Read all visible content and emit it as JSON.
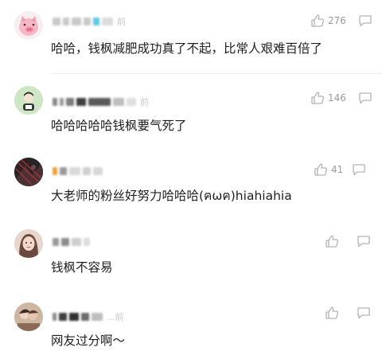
{
  "comments": [
    {
      "time_suffix": "前",
      "text": "哈哈，钱枫减肥成功真了不起，比常人艰难百倍了",
      "likes": "276",
      "avatar": "pink-pig-avatar"
    },
    {
      "time_suffix": "前",
      "text": "哈哈哈哈哈钱枫要气死了",
      "likes": "146",
      "avatar": "green-cartoon-avatar"
    },
    {
      "time_suffix": "",
      "text": "大老师的粉丝好努力哈哈哈(ฅωฅ)hiahiahia",
      "likes": "41",
      "avatar": "dark-photo-avatar"
    },
    {
      "time_suffix": "",
      "text": "钱枫不容易",
      "likes": "",
      "avatar": "girl-photo-avatar"
    },
    {
      "time_suffix": "...前",
      "text": "网友过分啊～",
      "likes": "",
      "avatar": "couple-photo-avatar"
    }
  ],
  "colors": {
    "icon": "#b4b4b4",
    "count": "#9a9a9a",
    "text": "#1e1e1e"
  },
  "icons": {
    "like": "thumbs-up-icon",
    "reply": "comment-bubble-icon"
  }
}
